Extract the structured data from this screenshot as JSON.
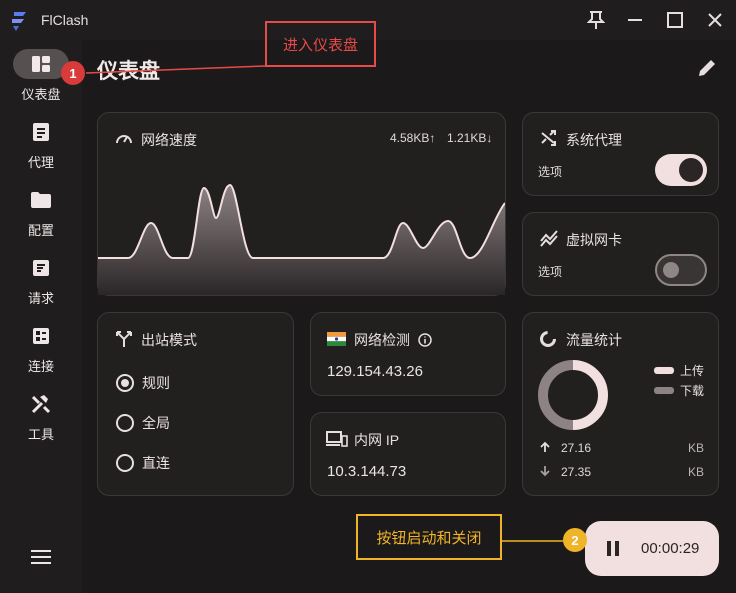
{
  "app": {
    "name": "FlClash"
  },
  "window_controls": [
    "pin-icon",
    "minimize-icon",
    "maximize-icon",
    "close-icon"
  ],
  "sidebar": {
    "items": [
      {
        "label": "仪表盘",
        "icon": "dashboard-icon",
        "active": true
      },
      {
        "label": "代理",
        "icon": "proxy-icon"
      },
      {
        "label": "配置",
        "icon": "folder-icon"
      },
      {
        "label": "请求",
        "icon": "request-icon"
      },
      {
        "label": "连接",
        "icon": "connection-icon"
      },
      {
        "label": "工具",
        "icon": "tools-icon"
      }
    ]
  },
  "page": {
    "title": "仪表盘"
  },
  "network_speed": {
    "title": "网络速度",
    "upload": "4.58KB↑",
    "download": "1.21KB↓"
  },
  "system_proxy": {
    "title": "系统代理",
    "sub": "选项",
    "enabled": true
  },
  "virtual_nic": {
    "title": "虚拟网卡",
    "sub": "选项",
    "enabled": false
  },
  "outbound_mode": {
    "title": "出站模式",
    "options": [
      "规则",
      "全局",
      "直连"
    ],
    "selected": "规则"
  },
  "network_check": {
    "title": "网络检测",
    "ip": "129.154.43.26",
    "flag": "india-flag-icon"
  },
  "intranet_ip": {
    "title": "内网 IP",
    "ip": "10.3.144.73"
  },
  "traffic_stats": {
    "title": "流量统计",
    "legend": {
      "upload": "上传",
      "download": "下载"
    },
    "upload_value": "27.16",
    "download_value": "27.35",
    "unit": "KB"
  },
  "fab": {
    "time": "00:00:29",
    "state": "running"
  },
  "annotations": [
    {
      "num": "1",
      "text": "进入仪表盘"
    },
    {
      "num": "2",
      "text": "按钮启动和关闭"
    }
  ],
  "colors": {
    "accent": "#f2dfe0",
    "annotation_red": "#e84a4a",
    "annotation_gold": "#f0b429"
  }
}
